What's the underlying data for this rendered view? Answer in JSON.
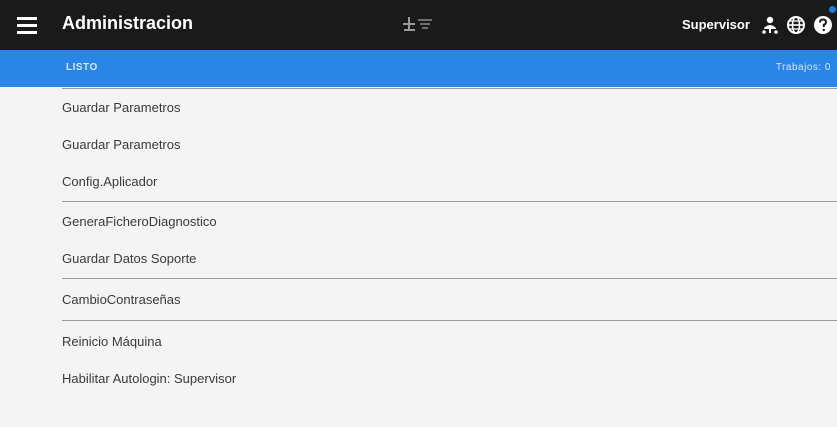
{
  "header": {
    "title": "Administracion",
    "user": "Supervisor"
  },
  "status": {
    "state": "LISTO",
    "jobs": "Trabajos: 0"
  },
  "menu": {
    "items": [
      "Guardar Parametros",
      "Guardar Parametros",
      "Config.Aplicador",
      "GeneraFicheroDiagnostico",
      "Guardar Datos Soporte",
      "CambioContraseñas",
      "Reinicio Máquina",
      "Habilitar Autologin: Supervisor"
    ]
  },
  "colors": {
    "topbar": "#1a1a1a",
    "statusbar": "#2a86e6",
    "background": "#f4f4f4"
  }
}
